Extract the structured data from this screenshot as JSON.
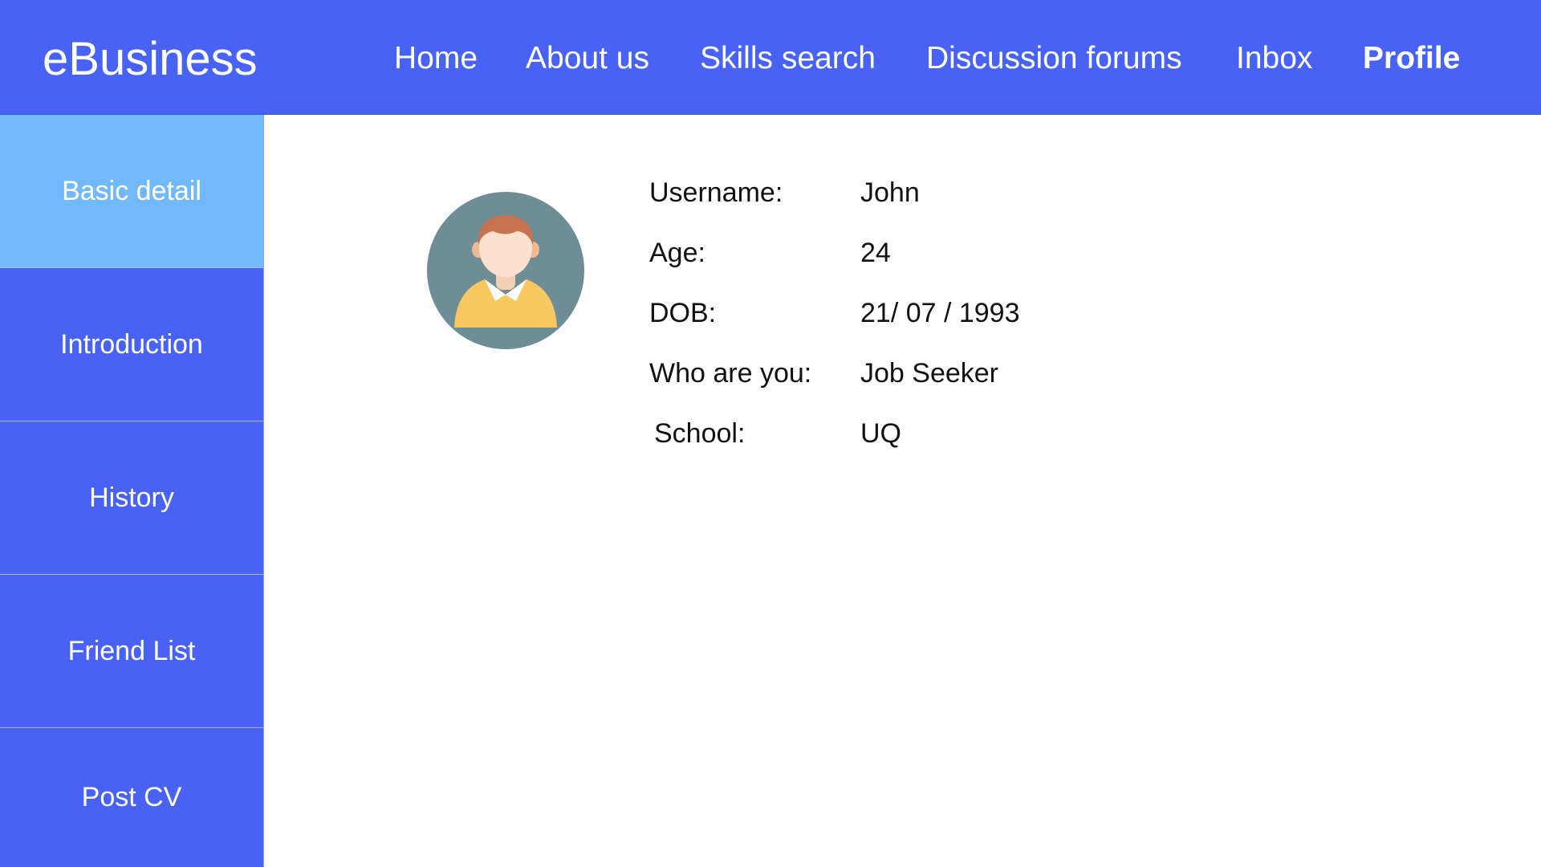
{
  "header": {
    "brand": "eBusiness",
    "nav": [
      {
        "label": "Home",
        "active": false
      },
      {
        "label": "About us",
        "active": false
      },
      {
        "label": "Skills search",
        "active": false
      },
      {
        "label": "Discussion forums",
        "active": false
      },
      {
        "label": "Inbox",
        "active": false
      },
      {
        "label": "Profile",
        "active": true
      }
    ]
  },
  "sidebar": {
    "items": [
      {
        "label": "Basic detail",
        "active": true
      },
      {
        "label": "Introduction",
        "active": false
      },
      {
        "label": "History",
        "active": false
      },
      {
        "label": "Friend List",
        "active": false
      },
      {
        "label": "Post CV",
        "active": false
      }
    ]
  },
  "profile": {
    "avatar_icon": "user-avatar-icon",
    "details": [
      {
        "label": "Username:",
        "value": "John"
      },
      {
        "label": "Age:",
        "value": "24"
      },
      {
        "label": "DOB:",
        "value": "21/ 07 / 1993"
      },
      {
        "label": "Who are you:",
        "value": "Job Seeker"
      },
      {
        "label": "School:",
        "value": "UQ"
      }
    ]
  },
  "colors": {
    "primary": "#4863f3",
    "sidebar_active": "#72b9fb",
    "text": "#111111",
    "background": "#ffffff"
  }
}
